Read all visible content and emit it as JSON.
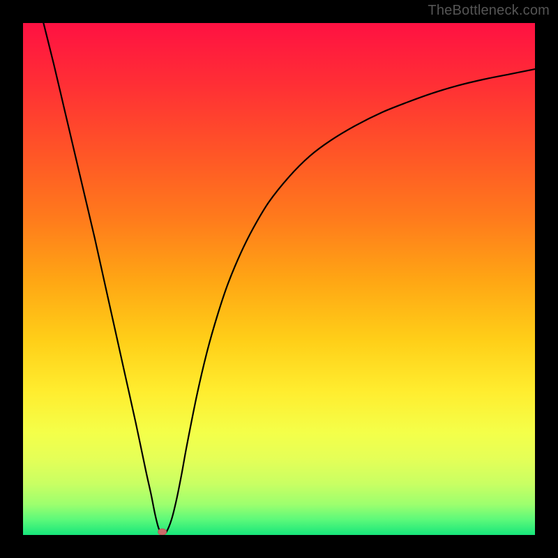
{
  "watermark": "TheBottleneck.com",
  "colors": {
    "frame": "#000000",
    "curve": "#000000",
    "marker_fill": "#cc6a6a",
    "marker_stroke": "#b85a5a",
    "gradient_stops": [
      {
        "offset": 0.0,
        "color": "#ff1142"
      },
      {
        "offset": 0.12,
        "color": "#ff2f35"
      },
      {
        "offset": 0.25,
        "color": "#ff5427"
      },
      {
        "offset": 0.38,
        "color": "#ff7a1c"
      },
      {
        "offset": 0.5,
        "color": "#ffa514"
      },
      {
        "offset": 0.62,
        "color": "#ffcf18"
      },
      {
        "offset": 0.72,
        "color": "#ffed2f"
      },
      {
        "offset": 0.8,
        "color": "#f4ff49"
      },
      {
        "offset": 0.85,
        "color": "#e5ff57"
      },
      {
        "offset": 0.9,
        "color": "#c9ff63"
      },
      {
        "offset": 0.94,
        "color": "#9dff6e"
      },
      {
        "offset": 0.97,
        "color": "#5cf97a"
      },
      {
        "offset": 1.0,
        "color": "#17e67b"
      }
    ]
  },
  "chart_data": {
    "type": "line",
    "title": "",
    "xlabel": "",
    "ylabel": "",
    "xlim": [
      0,
      100
    ],
    "ylim": [
      0,
      100
    ],
    "curve": [
      {
        "x": 2.0,
        "y": 108.0
      },
      {
        "x": 4.0,
        "y": 100.0
      },
      {
        "x": 6.0,
        "y": 92.0
      },
      {
        "x": 8.0,
        "y": 83.5
      },
      {
        "x": 10.0,
        "y": 75.0
      },
      {
        "x": 12.0,
        "y": 66.5
      },
      {
        "x": 14.0,
        "y": 58.0
      },
      {
        "x": 16.0,
        "y": 49.0
      },
      {
        "x": 18.0,
        "y": 40.0
      },
      {
        "x": 20.0,
        "y": 31.0
      },
      {
        "x": 22.0,
        "y": 22.0
      },
      {
        "x": 24.0,
        "y": 12.5
      },
      {
        "x": 25.0,
        "y": 8.0
      },
      {
        "x": 25.8,
        "y": 4.0
      },
      {
        "x": 26.5,
        "y": 1.3
      },
      {
        "x": 27.2,
        "y": 0.2
      },
      {
        "x": 28.0,
        "y": 0.6
      },
      {
        "x": 29.0,
        "y": 3.0
      },
      {
        "x": 30.0,
        "y": 7.0
      },
      {
        "x": 31.0,
        "y": 12.0
      },
      {
        "x": 32.0,
        "y": 17.5
      },
      {
        "x": 34.0,
        "y": 27.5
      },
      {
        "x": 36.0,
        "y": 36.0
      },
      {
        "x": 38.0,
        "y": 43.0
      },
      {
        "x": 40.0,
        "y": 49.0
      },
      {
        "x": 42.5,
        "y": 55.0
      },
      {
        "x": 45.0,
        "y": 60.0
      },
      {
        "x": 48.0,
        "y": 65.0
      },
      {
        "x": 52.0,
        "y": 70.0
      },
      {
        "x": 56.0,
        "y": 74.0
      },
      {
        "x": 60.0,
        "y": 77.0
      },
      {
        "x": 65.0,
        "y": 80.0
      },
      {
        "x": 70.0,
        "y": 82.5
      },
      {
        "x": 75.0,
        "y": 84.5
      },
      {
        "x": 80.0,
        "y": 86.3
      },
      {
        "x": 85.0,
        "y": 87.8
      },
      {
        "x": 90.0,
        "y": 89.0
      },
      {
        "x": 95.0,
        "y": 90.0
      },
      {
        "x": 100.0,
        "y": 91.0
      }
    ],
    "marker": {
      "x": 27.2,
      "y": 0.6,
      "rx": 6,
      "ry": 4.5
    }
  }
}
